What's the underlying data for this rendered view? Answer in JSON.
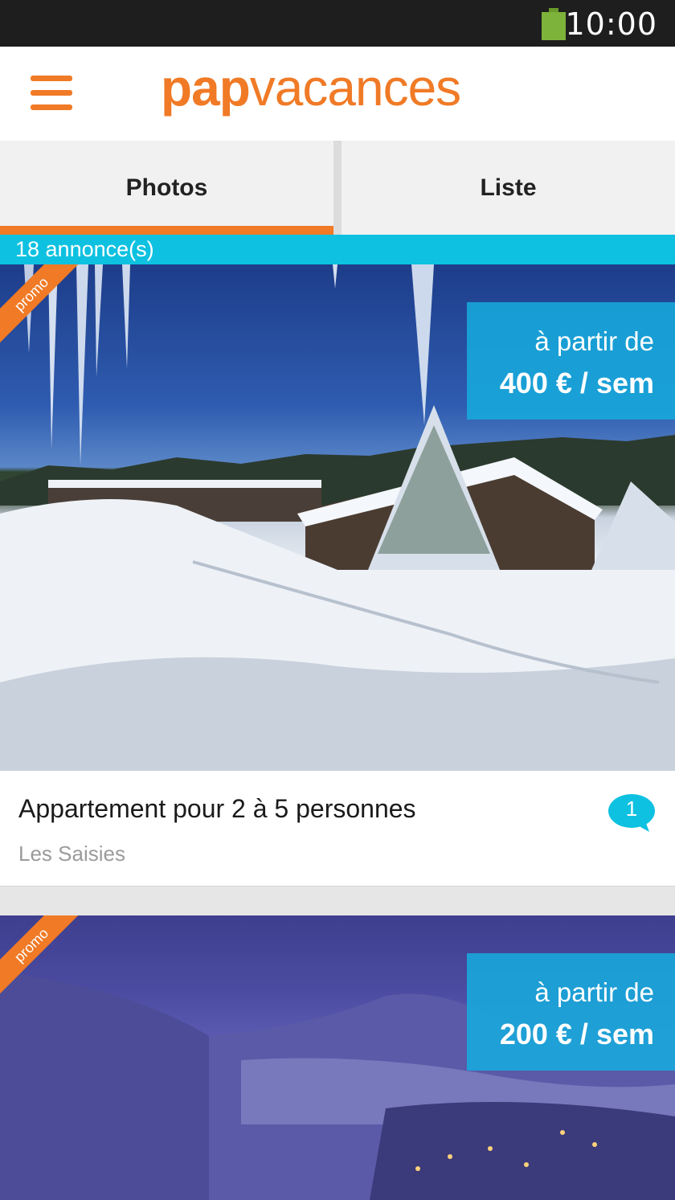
{
  "status_bar": {
    "time": "10:00",
    "battery_icon": "battery-icon"
  },
  "header": {
    "menu_icon": "hamburger-menu-icon",
    "logo": {
      "bold": "pap",
      "regular": "vacances"
    },
    "brand_color": "#f07a26"
  },
  "tabs": [
    {
      "label": "Photos",
      "active": true
    },
    {
      "label": "Liste",
      "active": false
    }
  ],
  "results": {
    "count_label": "18 annonce(s)",
    "accent_color": "#0ec1e0"
  },
  "listings": [
    {
      "badge": "promo",
      "price_from": "à partir de",
      "price": "400 € / sem",
      "title": "Appartement pour 2 à 5 personnes",
      "location": "Les Saisies",
      "message_count": "1",
      "message_icon": "speech-bubble-icon"
    },
    {
      "badge": "promo",
      "price_from": "à partir de",
      "price": "200 € / sem"
    }
  ]
}
